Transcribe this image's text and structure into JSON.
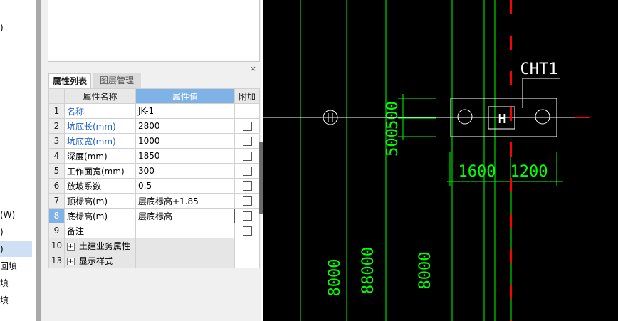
{
  "tree": {
    "items": [
      {
        "label": ")"
      },
      {
        "label": "(W)"
      },
      {
        "label": ")"
      },
      {
        "label": ")"
      },
      {
        "label": "回填"
      },
      {
        "label": "填"
      },
      {
        "label": "填"
      }
    ]
  },
  "panel": {
    "close_label": "×",
    "tabs": [
      {
        "label": "属性列表"
      },
      {
        "label": "图层管理"
      }
    ],
    "headers": {
      "name": "属性名称",
      "value": "属性值",
      "extra": "附加"
    },
    "rows": [
      {
        "num": "1",
        "name": "名称",
        "value": "JK-1"
      },
      {
        "num": "2",
        "name": "坑底长(mm)",
        "value": "2800"
      },
      {
        "num": "3",
        "name": "坑底宽(mm)",
        "value": "1000"
      },
      {
        "num": "4",
        "name": "深度(mm)",
        "value": "1850"
      },
      {
        "num": "5",
        "name": "工作面宽(mm)",
        "value": "300"
      },
      {
        "num": "6",
        "name": "放坡系数",
        "value": "0.5"
      },
      {
        "num": "7",
        "name": "顶标高(m)",
        "value": "层底标高+1.85"
      },
      {
        "num": "8",
        "name": "底标高(m)",
        "value": "层底标高"
      },
      {
        "num": "9",
        "name": "备注",
        "value": ""
      },
      {
        "num": "10",
        "name": "土建业务属性",
        "value": ""
      },
      {
        "num": "13",
        "name": "显示样式",
        "value": ""
      }
    ],
    "group_toggle": "+"
  },
  "cad": {
    "label_cht": "CHT1",
    "dim_500_top": "500",
    "dim_500_bottom": "500",
    "dim_1600": "1600",
    "dim_1200": "1200",
    "dim_8000_a": "8000",
    "dim_88000": "88000",
    "dim_8000_b": "8000",
    "pile_mark": "H",
    "colors": {
      "green": "#00ff00",
      "white": "#ffffff",
      "red": "#ff0000",
      "background": "#000000"
    }
  }
}
